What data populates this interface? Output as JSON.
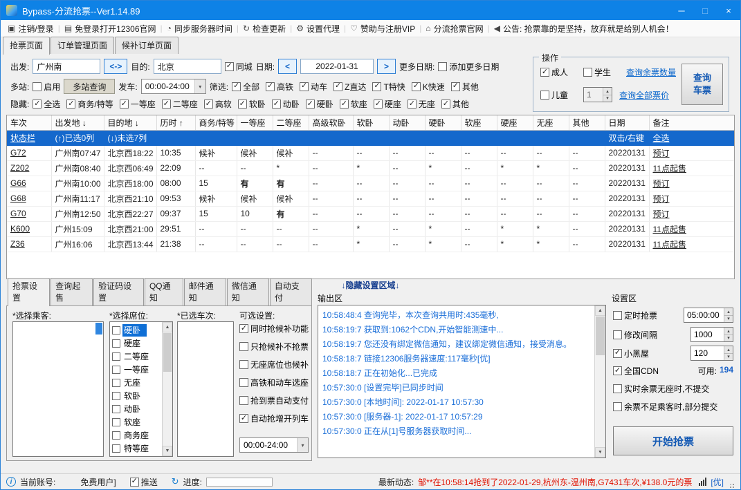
{
  "window": {
    "title": "Bypass-分流抢票--Ver1.14.89",
    "controls": {
      "minimize": "─",
      "maximize": "□",
      "close": "×"
    }
  },
  "icons": {
    "combo_arrow": "▾",
    "spin_up": "▴",
    "spin_down": "▾",
    "scroll_up": "▲",
    "scroll_down": "▼",
    "info": "i",
    "sync": "↻"
  },
  "menubar": {
    "separator": "|",
    "items": [
      {
        "icon": "monitor-icon",
        "glyph": "▣",
        "label": "注销/登录"
      },
      {
        "icon": "browser-icon",
        "glyph": "▤",
        "label": "免登录打开12306官网"
      },
      {
        "icon": "clock-icon",
        "glyph": "◔",
        "label": "同步服务器时间"
      },
      {
        "icon": "refresh-icon",
        "glyph": "↻",
        "label": "检查更新"
      },
      {
        "icon": "gear-icon",
        "glyph": "⚙",
        "label": "设置代理"
      },
      {
        "icon": "heart-icon",
        "glyph": "♡",
        "label": "赞助与注册VIP"
      },
      {
        "icon": "home-icon",
        "glyph": "⌂",
        "label": "分流抢票官网"
      },
      {
        "icon": "speaker-icon",
        "glyph": "◀",
        "label": "公告: 抢票靠的是坚持，放弃就是给别人机会！"
      }
    ]
  },
  "page_tabs": [
    {
      "label": "抢票页面",
      "active": true
    },
    {
      "label": "订单管理页面",
      "active": false
    },
    {
      "label": "候补订单页面",
      "active": false
    }
  ],
  "search": {
    "from_label": "出发:",
    "from_value": "广州南",
    "swap_glyph": "<->",
    "to_label": "目的:",
    "to_value": "北京",
    "same_city": {
      "label": "同城",
      "checked": true
    },
    "date_label": "日期:",
    "prev_glyph": "<",
    "date_value": "2022-01-31",
    "next_glyph": ">",
    "more_dates_label": "更多日期:",
    "add_more": {
      "label": "添加更多日期",
      "checked": false
    },
    "multi_label": "多站:",
    "enable": {
      "label": "启用",
      "checked": false
    },
    "multi_query_label": "多站查询",
    "depart_label": "发车:",
    "depart_value": "00:00-24:00",
    "filter_label": "筛选:",
    "filters": [
      {
        "label": "全部",
        "checked": true
      },
      {
        "label": "高铁",
        "checked": true
      },
      {
        "label": "动车",
        "checked": true
      },
      {
        "label": "Z直达",
        "checked": true
      },
      {
        "label": "T特快",
        "checked": true
      },
      {
        "label": "K快速",
        "checked": true
      },
      {
        "label": "其他",
        "checked": true
      }
    ],
    "hide_label": "隐藏:",
    "hides": [
      {
        "label": "全选",
        "checked": true
      },
      {
        "label": "商务/特等",
        "checked": true
      },
      {
        "label": "一等座",
        "checked": true
      },
      {
        "label": "二等座",
        "checked": true
      },
      {
        "label": "高软",
        "checked": true
      },
      {
        "label": "软卧",
        "checked": true
      },
      {
        "label": "动卧",
        "checked": true
      },
      {
        "label": "硬卧",
        "checked": true
      },
      {
        "label": "软座",
        "checked": true
      },
      {
        "label": "硬座",
        "checked": true
      },
      {
        "label": "无座",
        "checked": true
      },
      {
        "label": "其他",
        "checked": true
      }
    ]
  },
  "operation": {
    "title": "操作",
    "adult": {
      "label": "成人",
      "checked": true
    },
    "student": {
      "label": "学生",
      "checked": false
    },
    "child": {
      "label": "儿童",
      "checked": false
    },
    "child_count": "1",
    "link_seats": "查询余票数量",
    "link_price": "查询全部票价",
    "query_button": "查询车票"
  },
  "table": {
    "columns": [
      "车次",
      "出发地 ↓",
      "目的地 ↓",
      "历时 ↑",
      "商务/特等",
      "一等座",
      "二等座",
      "高级软卧",
      "软卧",
      "动卧",
      "硬卧",
      "软座",
      "硬座",
      "无座",
      "其他",
      "日期",
      "备注"
    ],
    "status_row": [
      "状态栏",
      "(↑)已选0列",
      "(↓)未选7列",
      "",
      "",
      "",
      "",
      "",
      "",
      "",
      "",
      "",
      "",
      "",
      "",
      "双击/右键",
      "全选"
    ],
    "rows": [
      [
        "G72",
        "广州南07:47",
        "北京西18:22",
        "10:35",
        "候补",
        "候补",
        "候补",
        "--",
        "--",
        "--",
        "--",
        "--",
        "--",
        "--",
        "--",
        "20220131",
        "预订"
      ],
      [
        "Z202",
        "广州南08:40",
        "北京西06:49",
        "22:09",
        "--",
        "--",
        "*",
        "--",
        "*",
        "--",
        "*",
        "--",
        "*",
        "*",
        "--",
        "20220131",
        "11点起售"
      ],
      [
        "G66",
        "广州南10:00",
        "北京西18:00",
        "08:00",
        "15",
        "有",
        "有",
        "--",
        "--",
        "--",
        "--",
        "--",
        "--",
        "--",
        "--",
        "20220131",
        "预订"
      ],
      [
        "G68",
        "广州南11:17",
        "北京西21:10",
        "09:53",
        "候补",
        "候补",
        "候补",
        "--",
        "--",
        "--",
        "--",
        "--",
        "--",
        "--",
        "--",
        "20220131",
        "预订"
      ],
      [
        "G70",
        "广州南12:50",
        "北京西22:27",
        "09:37",
        "15",
        "10",
        "有",
        "--",
        "--",
        "--",
        "--",
        "--",
        "--",
        "--",
        "--",
        "20220131",
        "预订"
      ],
      [
        "K600",
        "广州15:09",
        "北京西21:00",
        "29:51",
        "--",
        "--",
        "--",
        "--",
        "*",
        "--",
        "*",
        "--",
        "*",
        "*",
        "--",
        "20220131",
        "11点起售"
      ],
      [
        "Z36",
        "广州16:06",
        "北京西13:44",
        "21:38",
        "--",
        "--",
        "--",
        "--",
        "*",
        "--",
        "*",
        "--",
        "*",
        "*",
        "--",
        "20220131",
        "11点起售"
      ]
    ]
  },
  "divider_label": "↓隐藏设置区域↓",
  "sub_tabs": [
    {
      "label": "抢票设置",
      "active": true
    },
    {
      "label": "查询起售",
      "active": false
    },
    {
      "label": "验证码设置",
      "active": false
    },
    {
      "label": "QQ通知",
      "active": false
    },
    {
      "label": "邮件通知",
      "active": false
    },
    {
      "label": "微信通知",
      "active": false
    },
    {
      "label": "自动支付",
      "active": false
    }
  ],
  "grab": {
    "passengers_label": "*选择乘客:",
    "seats_label": "*选择席位:",
    "trains_label": "*已选车次:",
    "options_label": "可选设置:",
    "seats": [
      "硬卧",
      "硬座",
      "二等座",
      "一等座",
      "无座",
      "软卧",
      "动卧",
      "软座",
      "商务座",
      "特等座"
    ],
    "options": [
      {
        "label": "同时抢候补功能",
        "checked": true
      },
      {
        "label": "只抢候补不抢票",
        "checked": false
      },
      {
        "label": "无座席位也候补",
        "checked": false
      },
      {
        "label": "高铁和动车选座",
        "checked": false
      },
      {
        "label": "抢到票自动支付",
        "checked": false
      },
      {
        "label": "自动抢增开列车",
        "checked": true
      }
    ],
    "time_range": "00:00-24:00"
  },
  "output": {
    "title": "输出区",
    "logs": [
      "10:58:48:4  查询完毕，本次查询共用时:435毫秒,",
      "10:58:19:7  获取到:1062个CDN,开始智能测速中...",
      "10:58:19:7  您还没有绑定微信通知，建议绑定微信通知，接受消息。",
      "10:58:18:7  链接12306服务器速度:117毫秒[优]",
      "10:58:18:7  正在初始化...已完成",
      "10:57:30:0  [设置完毕]已同步时间",
      "10:57:30:0  [本地时间]:  2022-01-17 10:57:30",
      "10:57:30:0  [服务器-1]:  2022-01-17 10:57:29",
      "10:57:30:0  正在从[1]号服务器获取时间..."
    ]
  },
  "settings": {
    "title": "设置区",
    "timed": {
      "label": "定时抢票",
      "checked": false,
      "value": "05:00:00"
    },
    "interval": {
      "label": "修改间隔",
      "checked": false,
      "value": "1000"
    },
    "blackroom": {
      "label": "小黑屋",
      "checked": true,
      "value": "120"
    },
    "cdn": {
      "label": "全国CDN",
      "checked": true,
      "avail_label": "可用:",
      "avail_value": "194"
    },
    "no_seat": {
      "label": "实时余票无座时,不提交",
      "checked": false
    },
    "partial": {
      "label": "余票不足乘客时,部分提交",
      "checked": false
    },
    "start_button": "开始抢票"
  },
  "statusbar": {
    "account_label": "当前账号:",
    "account_value": "免费用户]",
    "push": {
      "label": "推送",
      "checked": true
    },
    "progress_label": "进度:",
    "news_label": "最新动态:",
    "news_text": "邹**在10:58:14抢到了2022-01-29,杭州东-温州南,G7431车次,¥138.0元的票",
    "signal_quality": "[优]"
  }
}
